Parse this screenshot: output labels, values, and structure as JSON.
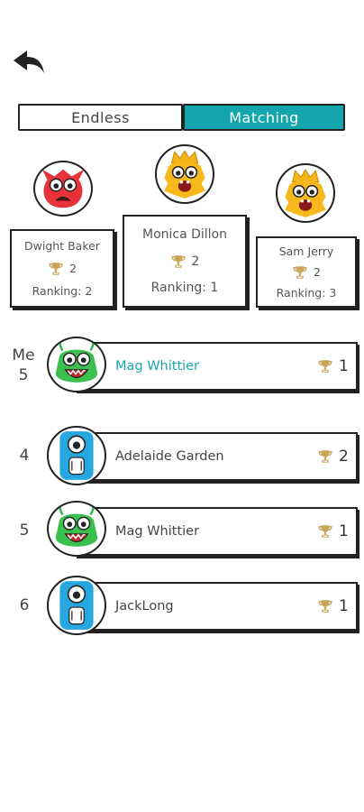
{
  "tabs": {
    "endless": "Endless",
    "matching": "Matching"
  },
  "accent_color": "#14a6ad",
  "podium": [
    {
      "name": "Dwight Baker",
      "trophies": "2",
      "ranking": "Ranking: 2",
      "monster": "red-monster"
    },
    {
      "name": "Monica Dillon",
      "trophies": "2",
      "ranking": "Ranking: 1",
      "monster": "yellow-crown-monster"
    },
    {
      "name": "Sam Jerry",
      "trophies": "2",
      "ranking": "Ranking: 3",
      "monster": "yellow-crown-monster"
    }
  ],
  "me": {
    "label": "Me",
    "rank": "5",
    "name": "Mag Whittier",
    "trophies": "1",
    "monster": "green-monster"
  },
  "list": [
    {
      "rank": "4",
      "name": "Adelaide Garden",
      "trophies": "2",
      "monster": "blue-monster"
    },
    {
      "rank": "5",
      "name": "Mag Whittier",
      "trophies": "1",
      "monster": "green-monster"
    },
    {
      "rank": "6",
      "name": "JackLong",
      "trophies": "1",
      "monster": "blue-monster"
    }
  ]
}
